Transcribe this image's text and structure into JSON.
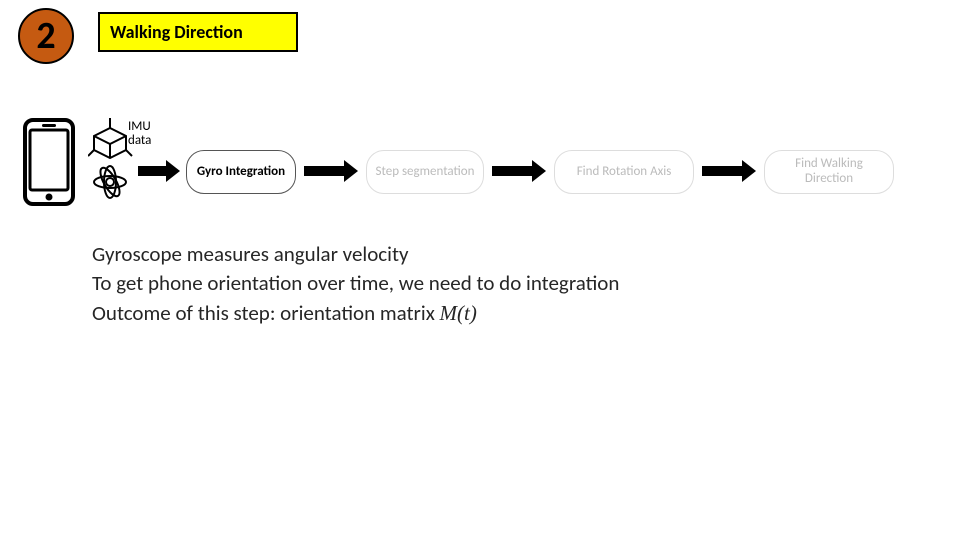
{
  "section": {
    "number": "2",
    "title": "Walking Direction"
  },
  "flow": {
    "imu_label_l1": "IMU",
    "imu_label_l2": "data",
    "node1": "Gyro Integration",
    "node2": "Step segmentation",
    "node3": "Find Rotation Axis",
    "node4": "Find Walking Direction"
  },
  "body": {
    "line1": "Gyroscope measures angular velocity",
    "line2": "To get phone orientation over time, we need to do integration",
    "line3_pre": "Outcome of this step:  orientation matrix ",
    "line3_formula": "M(t)"
  }
}
